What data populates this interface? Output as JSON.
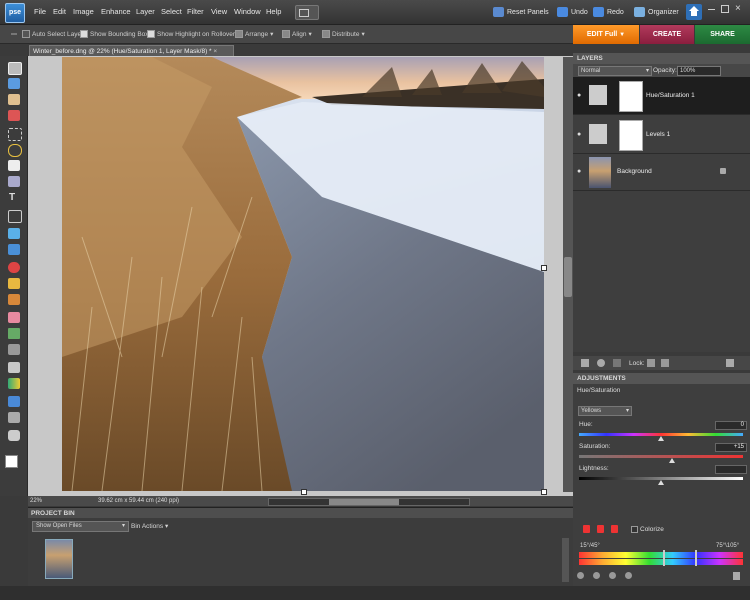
{
  "app": {
    "logo": "pse"
  },
  "menu": [
    "File",
    "Edit",
    "Image",
    "Enhance",
    "Layer",
    "Select",
    "Filter",
    "View",
    "Window",
    "Help"
  ],
  "topright": {
    "reset_panels": "Reset Panels",
    "undo": "Undo",
    "redo": "Redo",
    "organizer": "Organizer"
  },
  "options": {
    "auto_select": "Auto Select Layer",
    "bounding_box": "Show Bounding Box",
    "highlight": "Show Highlight on Rollover",
    "arrange": "Arrange",
    "align": "Align",
    "distribute": "Distribute"
  },
  "modes": {
    "edit": "EDIT Full",
    "create": "CREATE",
    "share": "SHARE"
  },
  "document": {
    "tab_title": "Winter_before.dng @ 22% (Hue/Saturation 1, Layer Mask/8) *",
    "zoom": "22%",
    "size": "39.62 cm x 59.44 cm (240 ppi)"
  },
  "project_bin": {
    "title": "PROJECT BIN",
    "show": "Show Open Files",
    "actions": "Bin Actions"
  },
  "layers_panel": {
    "title": "LAYERS",
    "blend_mode": "Normal",
    "opacity_label": "Opacity:",
    "opacity": "100%",
    "lock_label": "Lock:",
    "layers": [
      {
        "name": "Hue/Saturation 1"
      },
      {
        "name": "Levels 1"
      },
      {
        "name": "Background"
      }
    ]
  },
  "adjustments": {
    "title": "ADJUSTMENTS",
    "subtitle": "Hue/Saturation",
    "channel": "Yellows",
    "hue_label": "Hue:",
    "hue": "0",
    "hue_pos": 0.5,
    "sat_label": "Saturation:",
    "sat": "+15",
    "sat_pos": 0.57,
    "light_label": "Lightness:",
    "light_pos": 0.5,
    "colorize": "Colorize",
    "range_left": "15°/45°",
    "range_right": "75°\\105°"
  }
}
